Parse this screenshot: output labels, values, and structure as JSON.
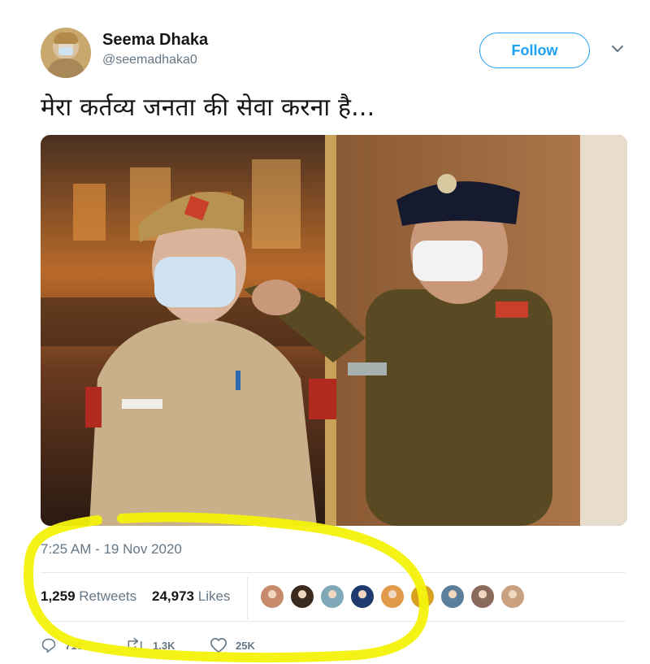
{
  "tweet": {
    "author_name": "Seema Dhaka",
    "author_handle": "@seemadhaka0",
    "follow_label": "Follow",
    "text": "मेरा कर्तव्य जनता की सेवा करना है...",
    "timestamp": "7:25 AM - 19 Nov 2020"
  },
  "stats": {
    "retweets_count": "1,259",
    "retweets_label": "Retweets",
    "likes_count": "24,973",
    "likes_label": "Likes"
  },
  "likers": [
    {
      "icon": "liker-avatar-1",
      "color": "#c78a6a"
    },
    {
      "icon": "liker-avatar-2",
      "color": "#3b2a1e"
    },
    {
      "icon": "liker-avatar-3",
      "color": "#7fa8b8"
    },
    {
      "icon": "liker-avatar-4",
      "color": "#1e3a6e"
    },
    {
      "icon": "liker-avatar-5",
      "color": "#e09a4a"
    },
    {
      "icon": "liker-avatar-6",
      "color": "#d8a020"
    },
    {
      "icon": "liker-avatar-7",
      "color": "#5b7f9a"
    },
    {
      "icon": "liker-avatar-8",
      "color": "#8a6a5a"
    },
    {
      "icon": "liker-avatar-9",
      "color": "#c9a080"
    }
  ],
  "actions": {
    "reply_count": "716",
    "retweet_count": "1.3K",
    "like_count": "25K"
  },
  "colors": {
    "accent": "#1da1f2",
    "muted": "#657786",
    "highlight": "#f4f20a"
  }
}
